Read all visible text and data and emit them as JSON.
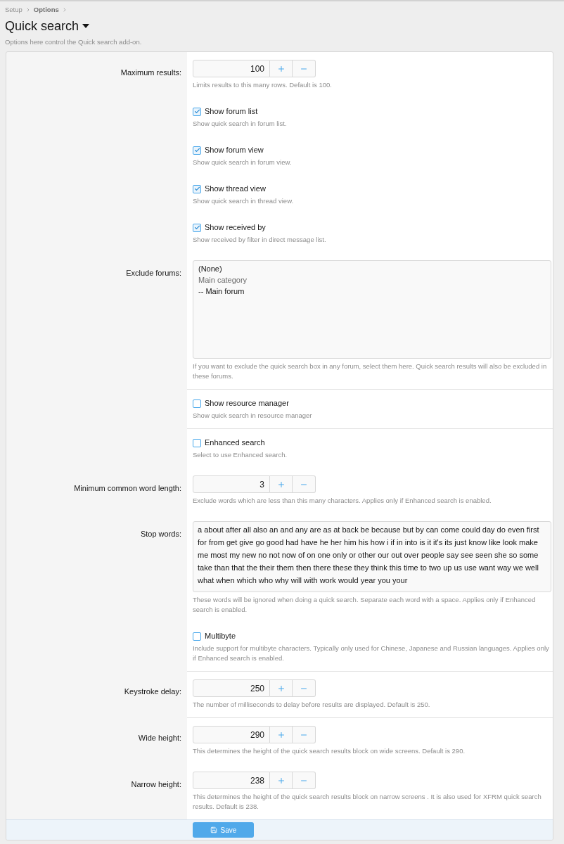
{
  "breadcrumb": [
    {
      "label": "Setup",
      "current": false
    },
    {
      "label": "Options",
      "current": true
    }
  ],
  "header": {
    "title": "Quick search",
    "description": "Options here control the Quick search add-on."
  },
  "groups": [
    {
      "rows": [
        {
          "kind": "spinner",
          "label": "Maximum results:",
          "value": "100",
          "hint": "Limits results to this many rows. Default is 100."
        },
        {
          "kind": "checkbox",
          "label": "Show forum list",
          "checked": true,
          "hint": "Show quick search in forum list."
        },
        {
          "kind": "checkbox",
          "label": "Show forum view",
          "checked": true,
          "hint": "Show quick search in forum view."
        },
        {
          "kind": "checkbox",
          "label": "Show thread view",
          "checked": true,
          "hint": "Show quick search in thread view."
        },
        {
          "kind": "checkbox",
          "label": "Show received by",
          "checked": true,
          "hint": "Show received by filter in direct message list."
        },
        {
          "kind": "select",
          "label": "Exclude forums:",
          "options": [
            {
              "label": "(None)",
              "disabled": false,
              "selected": false
            },
            {
              "label": "Main category",
              "disabled": true,
              "selected": false
            },
            {
              "label": "-- Main forum",
              "disabled": false,
              "selected": false
            }
          ],
          "hint": "If you want to exclude the quick search box in any forum, select them here. Quick search results will also be excluded in these forums."
        }
      ]
    },
    {
      "rows": [
        {
          "kind": "checkbox",
          "label": "Show resource manager",
          "checked": false,
          "hint": "Show quick search in resource manager"
        }
      ]
    },
    {
      "rows": [
        {
          "kind": "checkbox",
          "label": "Enhanced search",
          "checked": false,
          "hint": "Select to use Enhanced search."
        },
        {
          "kind": "spinner",
          "label": "Minimum common word length:",
          "value": "3",
          "hint": "Exclude words which are less than this many characters. Applies only if Enhanced search is enabled."
        },
        {
          "kind": "textarea",
          "label": "Stop words:",
          "value": "a about after all also an and any are as at back be because but by can come could day do even first for from get give go good had have he her him his how i if in into is it it's its just know like look make me most my new no not now of on one only or other our out over people say see seen she so some take than that the their them then there these they think this time to two up us use want way we well what when which who why will with work would year you your",
          "hint": "These words will be ignored when doing a quick search. Separate each word with a space. Applies only if Enhanced search is enabled."
        },
        {
          "kind": "checkbox",
          "label": "Multibyte",
          "checked": false,
          "hint": "Include support for multibyte characters. Typically only used for Chinese, Japanese and Russian languages. Applies only if Enhanced search is enabled."
        }
      ]
    },
    {
      "rows": [
        {
          "kind": "spinner",
          "label": "Keystroke delay:",
          "value": "250",
          "hint": "The number of milliseconds to delay before results are displayed. Default is 250."
        }
      ]
    },
    {
      "rows": [
        {
          "kind": "spinner",
          "label": "Wide height:",
          "value": "290",
          "hint": "This determines the height of the quick search results block on wide screens. Default is 290."
        },
        {
          "kind": "spinner",
          "label": "Narrow height:",
          "value": "238",
          "hint": "This determines the height of the quick search results block on narrow screens . It is also used for XFRM quick search results. Default is 238."
        }
      ]
    }
  ],
  "save_button": {
    "label": "Save"
  }
}
